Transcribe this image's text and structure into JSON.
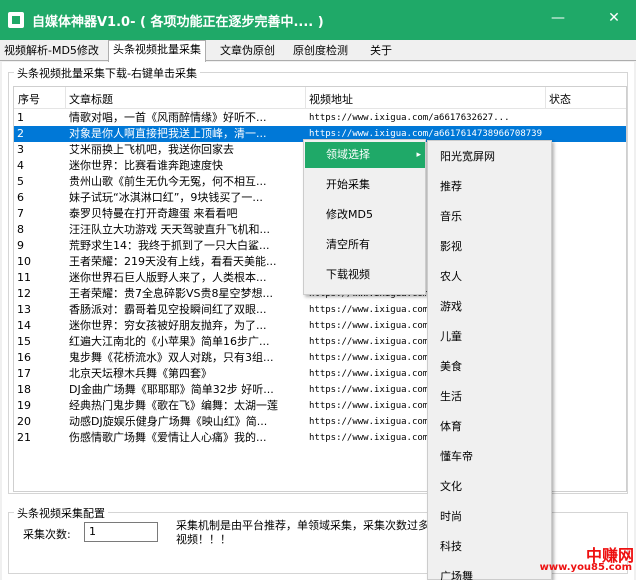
{
  "window": {
    "title": "自媒体神器V1.0- ( 各项功能正在逐步完善中.... )",
    "minimize": "—",
    "close": "✕"
  },
  "tabs": [
    {
      "label": "视频解析-MD5修改"
    },
    {
      "label": "头条视频批量采集"
    },
    {
      "label": "文章伪原创"
    },
    {
      "label": "原创度检测"
    },
    {
      "label": "关于"
    }
  ],
  "collect_group": {
    "label": "头条视频批量采集下载-右键单击采集",
    "columns": [
      "序号",
      "文章标题",
      "视频地址",
      "状态"
    ]
  },
  "rows": [
    {
      "idx": "1",
      "title": "情歌对唱，一首《风雨醉情缘》好听不...",
      "url": "https://www.ixigua.com/a6617632627...",
      "status": ""
    },
    {
      "idx": "2",
      "title": "对象是你人啊直接把我送上顶峰，清一...",
      "url": "https://www.ixigua.com/a6617614738966708739",
      "status": ""
    },
    {
      "idx": "3",
      "title": "艾米丽换上飞机吧，我送你回家去",
      "url": "",
      "status": ""
    },
    {
      "idx": "4",
      "title": "迷你世界：比赛看谁奔跑速度快",
      "url": "",
      "status": ""
    },
    {
      "idx": "5",
      "title": "贵州山歌《前生无仇今无冤，何不相互...",
      "url": "ht",
      "status": ""
    },
    {
      "idx": "6",
      "title": "妹子试玩“冰淇淋口红”，9块钱买了一...",
      "url": "ht",
      "status": ""
    },
    {
      "idx": "7",
      "title": "泰罗贝特曼在打开奇趣蛋 来看看吧",
      "url": "ht",
      "status": ""
    },
    {
      "idx": "8",
      "title": "汪汪队立大功游戏 天天驾驶直升飞机和...",
      "url": "ht",
      "status": ""
    },
    {
      "idx": "9",
      "title": "荒野求生14：我终于抓到了一只大白鲨...",
      "url": "ht",
      "status": ""
    },
    {
      "idx": "10",
      "title": "王者荣耀：219天没有上线，看看天美能...",
      "url": "ht",
      "status": ""
    },
    {
      "idx": "11",
      "title": "迷你世界石巨人版野人来了，人类根本...",
      "url": "ht",
      "status": ""
    },
    {
      "idx": "12",
      "title": "王者荣耀：贵7全息碎影VS贵8星空梦想...",
      "url": "https://www.ixigua.com/a66...",
      "status": ""
    },
    {
      "idx": "13",
      "title": "香肠派对：霸哥着见空投瞬间红了双眼...",
      "url": "https://www.ixigua.com/a66...",
      "status": ""
    },
    {
      "idx": "14",
      "title": "迷你世界：穷女孩被好朋友抛弃，为了...",
      "url": "https://www.ixigua.com/a66...",
      "status": ""
    },
    {
      "idx": "15",
      "title": "红遍大江南北的《小苹果》简单16步广...",
      "url": "https://www.ixigua.com/a66...",
      "status": ""
    },
    {
      "idx": "16",
      "title": "鬼步舞《花桥流水》双人对跳，只有3组...",
      "url": "https://www.ixigua.com/a66...",
      "status": ""
    },
    {
      "idx": "17",
      "title": "北京天坛穆木兵舞《第四套》",
      "url": "https://www.ixigua.com/a66...",
      "status": ""
    },
    {
      "idx": "18",
      "title": "DJ金曲广场舞《耶耶耶》简单32步 好听...",
      "url": "https://www.ixigua.com/a66...",
      "status": ""
    },
    {
      "idx": "19",
      "title": "经典热门鬼步舞《歌在飞》编舞：太湖一莲",
      "url": "https://www.ixigua.com/a66...",
      "status": ""
    },
    {
      "idx": "20",
      "title": "动感DJ旋娱乐健身广场舞《映山红》简...",
      "url": "https://www.ixigua.com/a66...",
      "status": ""
    },
    {
      "idx": "21",
      "title": "伤感情歌广场舞《爱情让人心痛》我的...",
      "url": "https://www.ixigua.com/a66...",
      "status": ""
    }
  ],
  "config_group": {
    "label": "头条视频采集配置",
    "count_label": "采集次数:",
    "count_value": "1",
    "note": "采集机制是由平台推荐，单领域采集，采集次数过多视频！！！"
  },
  "context_menu": {
    "items": [
      {
        "label": "领域选择",
        "submenu": true
      },
      {
        "label": "开始采集"
      },
      {
        "label": "修改MD5"
      },
      {
        "label": "清空所有"
      },
      {
        "label": "下载视频"
      }
    ],
    "submenu_arrow": "▸"
  },
  "submenu": {
    "items": [
      "阳光宽屏网",
      "推荐",
      "音乐",
      "影视",
      "农人",
      "游戏",
      "儿童",
      "美食",
      "生活",
      "体育",
      "懂车帝",
      "文化",
      "时尚",
      "科技",
      "广场舞"
    ]
  },
  "watermark": {
    "text": "中赚网",
    "sub": "www.you85.com"
  },
  "colors": {
    "titlebar": "#1fa968",
    "selection": "#0078d7",
    "menu_highlight": "#1fa968"
  }
}
